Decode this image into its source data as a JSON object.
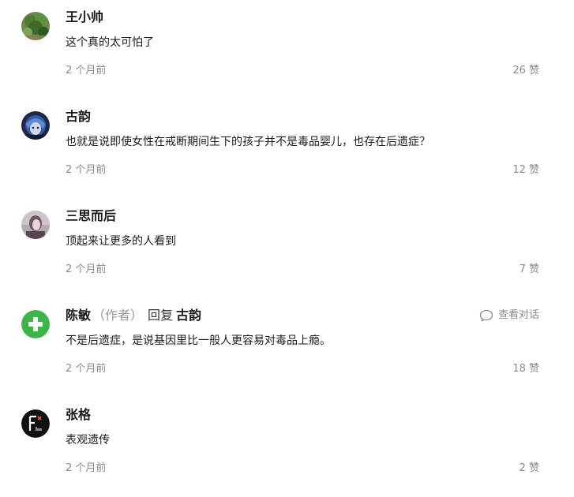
{
  "comments": [
    {
      "author": "王小帅",
      "content": "这个真的太可怕了",
      "time": "2 个月前",
      "likes": "26 赞",
      "avatar_icon": "plant-photo-avatar"
    },
    {
      "author": "古韵",
      "content": "也就是说即使女性在戒断期间生下的孩子并不是毒品婴儿，也存在后遗症？",
      "time": "2 个月前",
      "likes": "12 赞",
      "avatar_icon": "anime-character-avatar"
    },
    {
      "author": "三思而后",
      "content": "顶起来让更多的人看到",
      "time": "2 个月前",
      "likes": "7 赞",
      "avatar_icon": "portrait-photo-avatar"
    },
    {
      "author": "陈敏",
      "author_tag": "（作者）",
      "reply_word": "回复",
      "reply_target": "古韵",
      "view_conversation": "查看对话",
      "content": "不是后遗症，是说基因里比一般人更容易对毒品上瘾。",
      "time": "2 个月前",
      "likes": "18 赞",
      "avatar_icon": "green-plus-logo-avatar"
    },
    {
      "author": "张格",
      "content": "表观遗传",
      "time": "2 个月前",
      "likes": "2 赞",
      "avatar_icon": "film-logo-avatar"
    }
  ],
  "colors": {
    "text_primary": "#1a1a1a",
    "text_secondary": "#8a8a8a",
    "author_tag": "#999999",
    "green_avatar": "#3bb54a"
  }
}
